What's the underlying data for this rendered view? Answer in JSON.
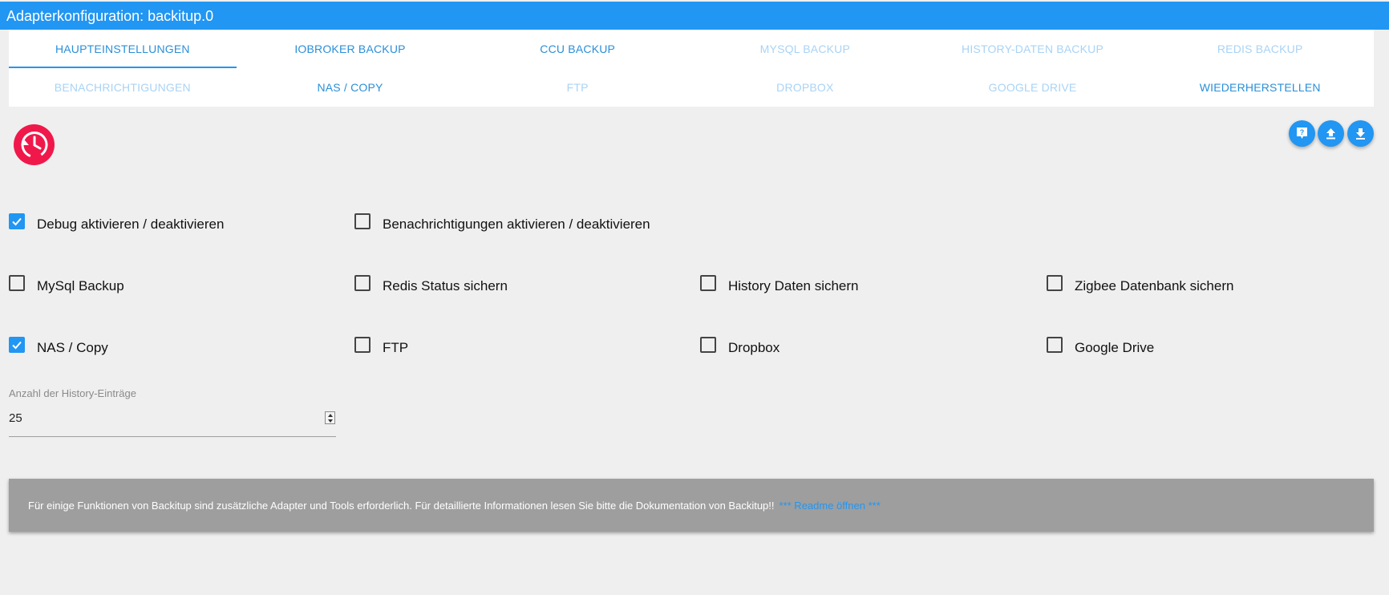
{
  "window": {
    "title": "Adapterkonfiguration: backitup.0"
  },
  "tabs": {
    "row1": [
      {
        "label": "HAUPTEINSTELLUNGEN"
      },
      {
        "label": "IOBROKER BACKUP"
      },
      {
        "label": "CCU BACKUP"
      },
      {
        "label": "MYSQL BACKUP"
      },
      {
        "label": "HISTORY-DATEN BACKUP"
      },
      {
        "label": "REDIS BACKUP"
      }
    ],
    "row2": [
      {
        "label": "BENACHRICHTIGUNGEN"
      },
      {
        "label": "NAS / COPY"
      },
      {
        "label": "FTP"
      },
      {
        "label": "DROPBOX"
      },
      {
        "label": "GOOGLE DRIVE"
      },
      {
        "label": "WIEDERHERSTELLEN"
      }
    ]
  },
  "toolbar": {
    "help_icon": "help-icon",
    "upload_icon": "upload-icon",
    "download_icon": "download-icon"
  },
  "options": {
    "debug": {
      "label": "Debug aktivieren / deaktivieren",
      "checked": true
    },
    "notifications": {
      "label": "Benachrichtigungen aktivieren / deaktivieren",
      "checked": false
    },
    "mysql": {
      "label": "MySql Backup",
      "checked": false
    },
    "redis": {
      "label": "Redis Status sichern",
      "checked": false
    },
    "history": {
      "label": "History Daten sichern",
      "checked": false
    },
    "zigbee": {
      "label": "Zigbee Datenbank sichern",
      "checked": false
    },
    "nas": {
      "label": "NAS / Copy",
      "checked": true
    },
    "ftp": {
      "label": "FTP",
      "checked": false
    },
    "dropbox": {
      "label": "Dropbox",
      "checked": false
    },
    "googledrive": {
      "label": "Google Drive",
      "checked": false
    }
  },
  "history_entries": {
    "label": "Anzahl der History-Einträge",
    "value": "25"
  },
  "info": {
    "text": "Für einige Funktionen von Backitup sind zusätzliche Adapter und Tools erforderlich. Für detaillierte Informationen lesen Sie bitte die Dokumentation von Backitup!!",
    "link": "*** Readme öffnen ***"
  },
  "colors": {
    "accent": "#2196f3",
    "logo": "#f0184a",
    "info_bg": "#9e9e9e"
  }
}
